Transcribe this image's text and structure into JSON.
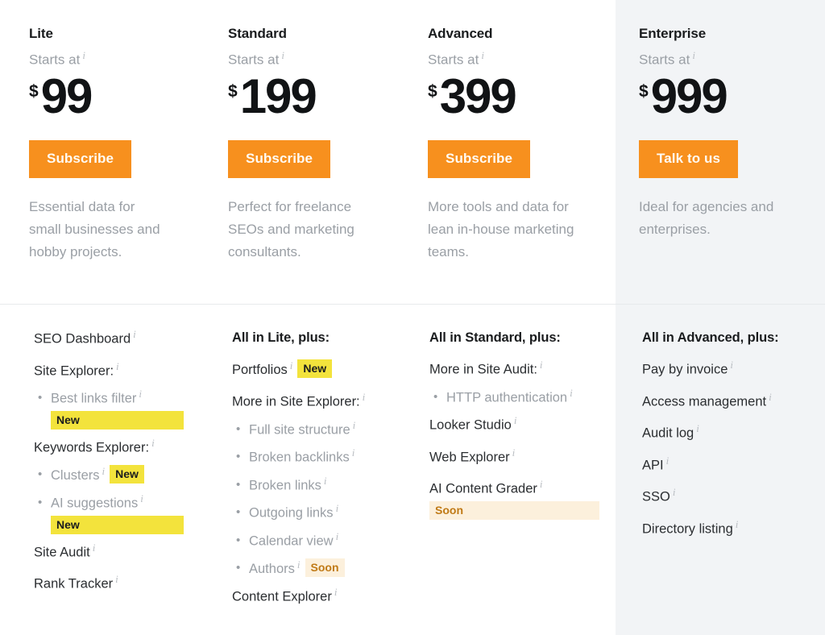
{
  "layout": {
    "highlight_column": "Enterprise",
    "highlight_bg": "#f2f4f6",
    "accent_color": "#f7901e",
    "badge_new_color": "#f3e33c",
    "badge_soon_color": "#fcf0dc",
    "divider_color": "#e7eaec"
  },
  "labels": {
    "starts_at": "Starts at",
    "info_icon": "i",
    "currency_symbol": "$",
    "badge_new": "New",
    "badge_soon": "Soon"
  },
  "plans": [
    {
      "name": "Lite",
      "starts_at": "Starts at",
      "currency": "$",
      "price": "99",
      "cta": "Subscribe",
      "blurb": "Essential data for small businesses and hobby projects."
    },
    {
      "name": "Standard",
      "starts_at": "Starts at",
      "currency": "$",
      "price": "199",
      "cta": "Subscribe",
      "blurb": "Perfect for freelance SEOs and marketing consultants."
    },
    {
      "name": "Advanced",
      "starts_at": "Starts at",
      "currency": "$",
      "price": "399",
      "cta": "Subscribe",
      "blurb": "More tools and data for lean in-house marketing teams."
    },
    {
      "name": "Enterprise",
      "starts_at": "Starts at",
      "currency": "$",
      "price": "999",
      "cta": "Talk to us",
      "blurb": "Ideal for agencies and enterprises."
    }
  ],
  "feature_columns": [
    {
      "plan": "Lite",
      "heading": null,
      "items": [
        {
          "label": "SEO Dashboard",
          "info": true,
          "level": "top"
        },
        {
          "label": "Site Explorer:",
          "info": true,
          "level": "group"
        },
        {
          "label": "Best links filter",
          "info": true,
          "level": "sub",
          "badge": "New",
          "badge_type": "new",
          "badge_wrapped": true
        },
        {
          "label": "Keywords Explorer:",
          "info": true,
          "level": "group"
        },
        {
          "label": "Clusters",
          "info": true,
          "level": "sub",
          "badge": "New",
          "badge_type": "new"
        },
        {
          "label": "AI suggestions",
          "info": true,
          "level": "sub",
          "badge": "New",
          "badge_type": "new",
          "badge_wrapped": true
        },
        {
          "label": "Site Audit",
          "info": true,
          "level": "top"
        },
        {
          "label": "Rank Tracker",
          "info": true,
          "level": "top"
        }
      ]
    },
    {
      "plan": "Standard",
      "heading": "All in Lite, plus:",
      "items": [
        {
          "label": "Portfolios",
          "info": true,
          "level": "top",
          "badge": "New",
          "badge_type": "new"
        },
        {
          "label": "More in Site Explorer:",
          "info": true,
          "level": "group"
        },
        {
          "label": "Full site structure",
          "info": true,
          "level": "sub"
        },
        {
          "label": "Broken backlinks",
          "info": true,
          "level": "sub"
        },
        {
          "label": "Broken links",
          "info": true,
          "level": "sub"
        },
        {
          "label": "Outgoing links",
          "info": true,
          "level": "sub"
        },
        {
          "label": "Calendar view",
          "info": true,
          "level": "sub"
        },
        {
          "label": "Authors",
          "info": true,
          "level": "sub",
          "badge": "Soon",
          "badge_type": "soon"
        },
        {
          "label": "Content Explorer",
          "info": true,
          "level": "top"
        }
      ]
    },
    {
      "plan": "Advanced",
      "heading": "All in Standard, plus:",
      "items": [
        {
          "label": "More in Site Audit:",
          "info": true,
          "level": "group"
        },
        {
          "label": "HTTP authentication",
          "info": true,
          "level": "sub"
        },
        {
          "label": "Looker Studio",
          "info": true,
          "level": "top"
        },
        {
          "label": "Web Explorer",
          "info": true,
          "level": "top"
        },
        {
          "label": "AI Content Grader",
          "info": true,
          "level": "top",
          "badge": "Soon",
          "badge_type": "soon",
          "badge_wrapped": true
        }
      ]
    },
    {
      "plan": "Enterprise",
      "heading": "All in Advanced, plus:",
      "items": [
        {
          "label": "Pay by invoice",
          "info": true,
          "level": "top"
        },
        {
          "label": "Access management",
          "info": true,
          "level": "top"
        },
        {
          "label": "Audit log",
          "info": true,
          "level": "top"
        },
        {
          "label": "API",
          "info": true,
          "level": "top"
        },
        {
          "label": "SSO",
          "info": true,
          "level": "top"
        },
        {
          "label": "Directory listing",
          "info": true,
          "level": "top"
        }
      ]
    }
  ]
}
